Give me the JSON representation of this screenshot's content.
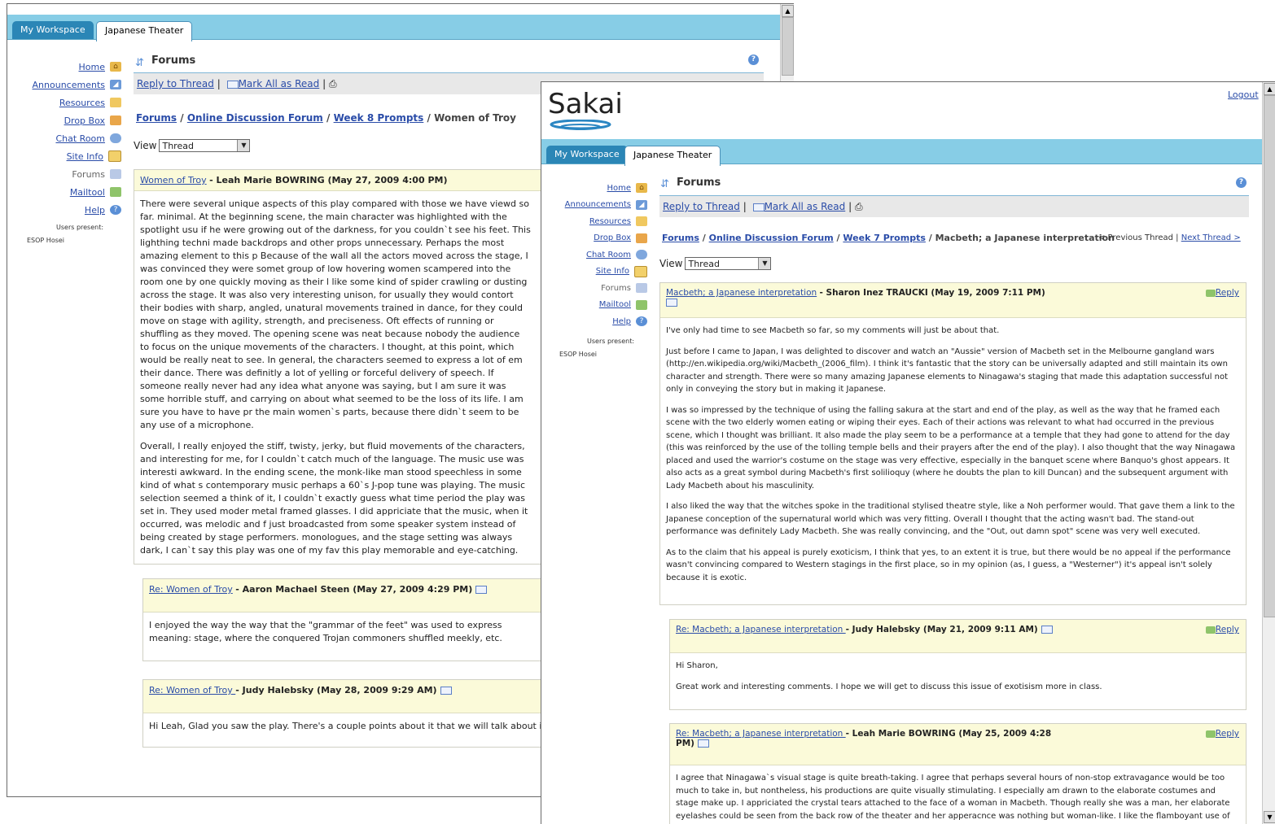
{
  "tabs": {
    "my_workspace": "My Workspace",
    "site": "Japanese Theater"
  },
  "tools": [
    {
      "label": "Home",
      "icon": "house-icon"
    },
    {
      "label": "Announcements",
      "icon": "megaphone-icon"
    },
    {
      "label": "Resources",
      "icon": "folder-icon"
    },
    {
      "label": "Drop Box",
      "icon": "dropbox-icon"
    },
    {
      "label": "Chat Room",
      "icon": "chat-icon"
    },
    {
      "label": "Site Info",
      "icon": "info-icon"
    },
    {
      "label": "Forums",
      "icon": "forums-icon"
    },
    {
      "label": "Mailtool",
      "icon": "mail-icon"
    },
    {
      "label": "Help",
      "icon": "help-icon"
    }
  ],
  "users_present_label": "Users present:",
  "users_present_name": "ESOP Hosei",
  "tool_title": "Forums",
  "actions": {
    "reply_to_thread": "Reply to Thread",
    "sep": "|",
    "mark_all_read": "Mark All as Read"
  },
  "view_label": "View",
  "view_value": "Thread",
  "back_window": {
    "crumbs": {
      "forums": "Forums",
      "forum": "Online Discussion Forum",
      "topic": "Week 8 Prompts",
      "thread": "Women of Troy",
      "sep": "/"
    },
    "main_message": {
      "title": "Women of Troy",
      "author_date": "- Leah Marie BOWRING (May 27, 2009 4:00 PM)",
      "paragraphs": [
        "There were several unique aspects of this play compared with those we have viewd so far. minimal.  At the beginning scene, the main character was highlighted with the spotlight usu if he were growing out of the darkness, for you couldn`t see his feet.  This lighthing techni made backdrops and other props unnecessary.  Perhaps the most amazing element to this p Because of the wall all the actors moved across the stage, I was convinced they were somet group of low hovering women scampered into the room one by one quickly moving as their l like some kind of spider crawling or dusting across the stage.  It was also very interesting unison, for usually they would contort their bodies with sharp, angled, unatural movements trained in dance, for they could move on stage with agility, strength, and preciseness.  Oft effects of running or shuffling as they moved.  The opening scene was neat because nobody the audience to focus on the unique movements of the characters.  I thought, at this point, which would be really neat to see.  In general, the characters seemed to express a lot of em their dance.  There was definitly a lot of yelling or forceful delivery of speech.  If someone really never had any idea what anyone was saying, but I am sure it was some horrible stuff, and carrying on about what seemed to be the loss of its life.  I am sure you have to have pr the main women`s parts, because there didn`t seem to be any use of a microphone.",
        "Overall, I really enjoyed the stiff, twisty, jerky, but fluid movements of the characters, and interesting for me, for I couldn`t catch much of the language.  The music use was interesti awkward.  In the ending scene, the monk-like man stood speechless in some kind of what s contemporary music perhaps a 60`s J-pop tune was playing.  The music selection seemed a think of it, I couldn`t exactly guess what time period the play was set in.  They used moder metal framed glasses.  I did appriciate that the music, when it occurred, was melodic and f just broadcasted from some speaker system instead of being created by stage performers. monologues, and the stage setting was always dark, I can`t say this play was one of my fav this play memorable and eye-catching."
      ]
    },
    "replies": [
      {
        "title": "Re: Women of Troy",
        "author_date": "- Aaron Machael Steen (May 27, 2009 4:29 PM)",
        "body": "I enjoyed the way the way that the \"grammar of the feet\" was used to express meaning: stage, where the conquered Trojan commoners shuffled meekly, etc."
      },
      {
        "title": "Re: Women of Troy ",
        "author_date": "- Judy Halebsky (May 28, 2009 9:29 AM)",
        "body": "Hi Leah, Glad you saw the play. There's a couple points about it that we will talk about in"
      }
    ]
  },
  "front_window": {
    "logo_text": "Sakai",
    "logout": "Logout",
    "crumbs": {
      "forums": "Forums",
      "forum": "Online Discussion Forum",
      "topic": "Week 7 Prompts",
      "thread": "Macbeth; a Japanese interpretation",
      "sep": "/"
    },
    "thread_nav": {
      "previous": "< Previous Thread",
      "sep": "|",
      "next": "Next Thread >"
    },
    "reply_label": "Reply",
    "main_message": {
      "title": "Macbeth; a Japanese interpretation",
      "author_date": "- Sharon Inez TRAUCKI (May 19, 2009 7:11 PM)",
      "paragraphs": [
        "I've only had time to see Macbeth so far, so my comments will just be about that.",
        "Just before I came to Japan, I was delighted to discover and watch an \"Aussie\" version of Macbeth set in the Melbourne gangland wars (http://en.wikipedia.org/wiki/Macbeth_(2006_film). I think it's fantastic that the story can be universally adapted and still maintain its own character and strength. There were so many amazing Japanese elements to Ninagawa's staging that made this adaptation successful not only in conveying the story but in making it Japanese.",
        "I was so impressed by the technique of using the falling sakura at the start and end of the play, as well as the way that he framed each scene with the two elderly women eating or wiping their eyes. Each of their actions was relevant to what had occurred in the previous scene, which I thought was brilliant. It also made the play seem to be a performance at a temple that they had gone to attend for the day (this was reinforced by the use of the tolling temple bells and their prayers after the end of the play). I also thought that the way Ninagawa placed and used the warrior's costume on the stage was very effective, especially in the banquet scene where Banquo's ghost appears. It also acts as a great symbol during Macbeth's first solilioquy (where he doubts the plan to kill Duncan) and the subsequent argument with Lady Macbeth about his masculinity.",
        "I also liked the way that the witches spoke in the traditional stylised theatre style, like a Noh performer would. That gave them a link to the Japanese conception of the supernatural world which was very fitting. Overall I thought that the acting wasn't bad. The stand-out performance was definitely Lady Macbeth. She was really convincing, and the \"Out, out damn spot\" scene was very well executed.",
        "As to the claim that his appeal is purely exoticism, I think that yes, to an extent it is true, but there would be no appeal if the performance wasn't convincing compared to Western stagings in the first place, so in my opinion (as, I guess, a \"Westerner\") it's appeal isn't solely because it is exotic."
      ]
    },
    "replies": [
      {
        "title": "Re: Macbeth; a Japanese interpretation ",
        "author_date": "- Judy Halebsky (May 21, 2009 9:11 AM)",
        "paragraphs": [
          "Hi Sharon,",
          "Great work and interesting comments. I hope we will get to discuss this issue of exotisism more in class."
        ]
      },
      {
        "title": "Re: Macbeth; a Japanese interpretation ",
        "author_date": "- Leah Marie BOWRING (May 25, 2009 4:28 PM)",
        "paragraphs": [
          "I agree that Ninagawa`s visual stage is quite breath-taking.  I agree that perhaps several hours of non-stop extravagance would be too much to take in, but nontheless, his productions are quite visually stimulating.  I especially am drawn to the elaborate costumes and stage make up.  I appriciated the crystal tears attached to the face of a woman in Macbeth.  Though really she was a man, her elaborate eyelashes could be seen from the back row of the theater and her apperacnce was nothing but woman-like.  I like the flamboyant use of"
        ]
      }
    ]
  }
}
